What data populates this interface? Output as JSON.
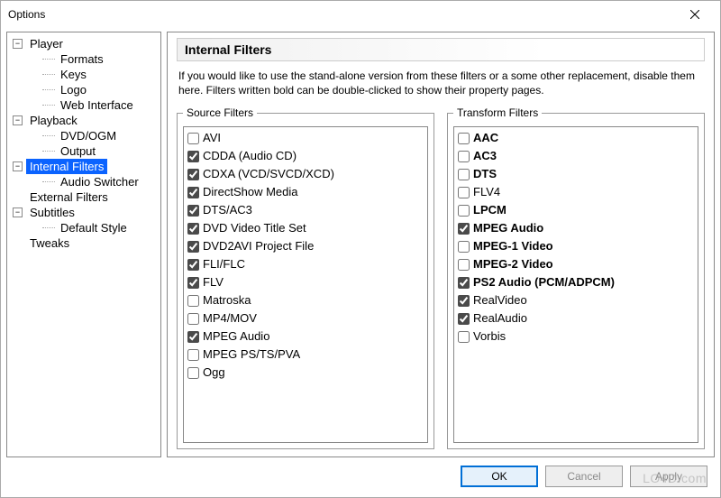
{
  "window": {
    "title": "Options"
  },
  "tree": {
    "items": [
      {
        "label": "Player",
        "children": [
          {
            "label": "Formats"
          },
          {
            "label": "Keys"
          },
          {
            "label": "Logo"
          },
          {
            "label": "Web Interface"
          }
        ]
      },
      {
        "label": "Playback",
        "children": [
          {
            "label": "DVD/OGM"
          },
          {
            "label": "Output"
          }
        ]
      },
      {
        "label": "Internal Filters",
        "selected": true,
        "children": [
          {
            "label": "Audio Switcher"
          }
        ]
      },
      {
        "label": "External Filters"
      },
      {
        "label": "Subtitles",
        "children": [
          {
            "label": "Default Style"
          }
        ]
      },
      {
        "label": "Tweaks"
      }
    ]
  },
  "page": {
    "heading": "Internal Filters",
    "description": "If you would like to use the stand-alone version from these filters or a some other replacement, disable them here. Filters written bold can be double-clicked to show their property pages.",
    "source_legend": "Source Filters",
    "transform_legend": "Transform Filters",
    "source_filters": [
      {
        "label": "AVI",
        "checked": false,
        "bold": false
      },
      {
        "label": "CDDA (Audio CD)",
        "checked": true,
        "bold": false
      },
      {
        "label": "CDXA (VCD/SVCD/XCD)",
        "checked": true,
        "bold": false
      },
      {
        "label": "DirectShow Media",
        "checked": true,
        "bold": false
      },
      {
        "label": "DTS/AC3",
        "checked": true,
        "bold": false
      },
      {
        "label": "DVD Video Title Set",
        "checked": true,
        "bold": false
      },
      {
        "label": "DVD2AVI Project File",
        "checked": true,
        "bold": false
      },
      {
        "label": "FLI/FLC",
        "checked": true,
        "bold": false
      },
      {
        "label": "FLV",
        "checked": true,
        "bold": false
      },
      {
        "label": "Matroska",
        "checked": false,
        "bold": false
      },
      {
        "label": "MP4/MOV",
        "checked": false,
        "bold": false
      },
      {
        "label": "MPEG Audio",
        "checked": true,
        "bold": false
      },
      {
        "label": "MPEG PS/TS/PVA",
        "checked": false,
        "bold": false
      },
      {
        "label": "Ogg",
        "checked": false,
        "bold": false
      }
    ],
    "transform_filters": [
      {
        "label": "AAC",
        "checked": false,
        "bold": true
      },
      {
        "label": "AC3",
        "checked": false,
        "bold": true
      },
      {
        "label": "DTS",
        "checked": false,
        "bold": true
      },
      {
        "label": "FLV4",
        "checked": false,
        "bold": false
      },
      {
        "label": "LPCM",
        "checked": false,
        "bold": true
      },
      {
        "label": "MPEG Audio",
        "checked": true,
        "bold": true
      },
      {
        "label": "MPEG-1 Video",
        "checked": false,
        "bold": true
      },
      {
        "label": "MPEG-2 Video",
        "checked": false,
        "bold": true
      },
      {
        "label": "PS2 Audio (PCM/ADPCM)",
        "checked": true,
        "bold": true
      },
      {
        "label": "RealVideo",
        "checked": true,
        "bold": false
      },
      {
        "label": "RealAudio",
        "checked": true,
        "bold": false
      },
      {
        "label": "Vorbis",
        "checked": false,
        "bold": false
      }
    ]
  },
  "buttons": {
    "ok": "OK",
    "cancel": "Cancel",
    "apply": "Apply"
  },
  "watermark": "LO4D.com",
  "icons": {
    "minus": "−",
    "plus": "+"
  }
}
